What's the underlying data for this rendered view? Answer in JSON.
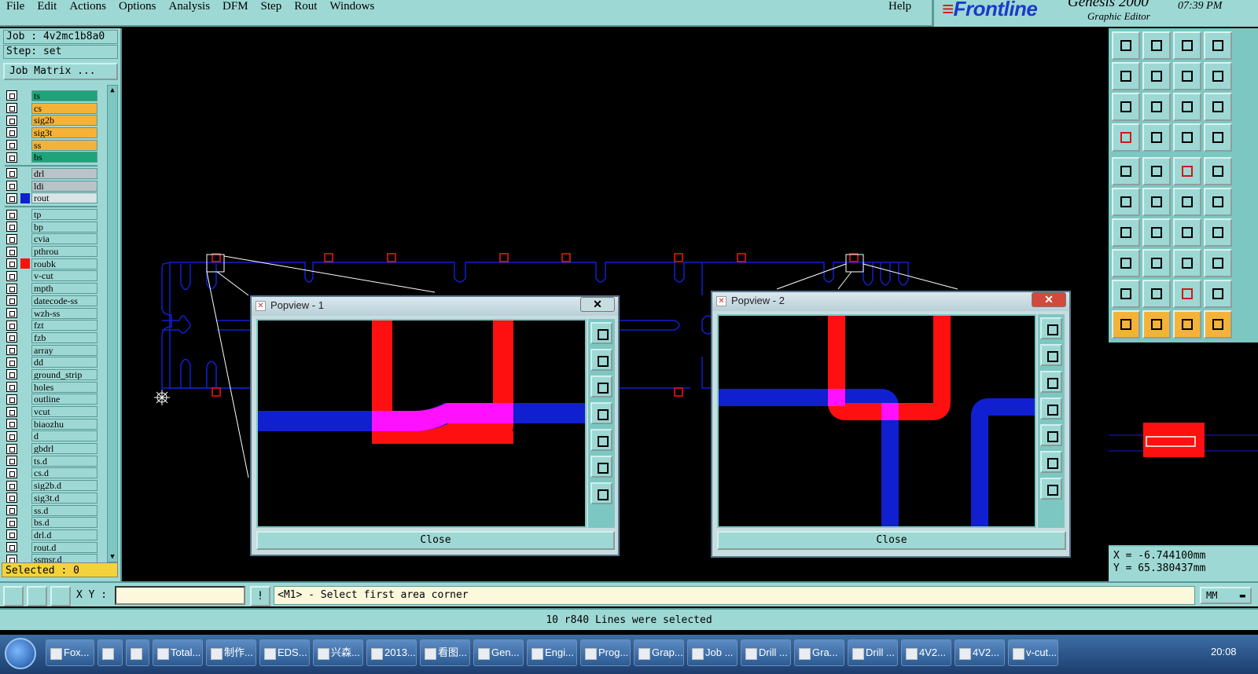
{
  "menu": {
    "items": [
      "File",
      "Edit",
      "Actions",
      "Options",
      "Analysis",
      "DFM",
      "Step",
      "Rout",
      "Windows"
    ],
    "help": "Help"
  },
  "brand": {
    "logo": "Frontline",
    "product": "Genesis 2000",
    "subtitle": "Graphic Editor",
    "time": "07:39 PM"
  },
  "job": {
    "job_line": "Job : 4v2mc1b8a0",
    "step_line": "Step: set",
    "matrix_button": "Job Matrix ..."
  },
  "layers": {
    "group1": [
      {
        "name": "ts",
        "color": "#1ea37a"
      },
      {
        "name": "cs",
        "color": "#f4b338"
      },
      {
        "name": "sig2b",
        "color": "#f4b338"
      },
      {
        "name": "sig3t",
        "color": "#f4b338"
      },
      {
        "name": "ss",
        "color": "#f4b338"
      },
      {
        "name": "bs",
        "color": "#1ea37a"
      }
    ],
    "group2": [
      {
        "name": "drl",
        "color": "#b9c4c8"
      },
      {
        "name": "ldi",
        "color": "#b9c4c8"
      },
      {
        "name": "rout",
        "color": "#d8e4e6",
        "swatch": "#1020d0",
        "active": true
      }
    ],
    "group3": [
      {
        "name": "tp"
      },
      {
        "name": "bp"
      },
      {
        "name": "cvia"
      },
      {
        "name": "pthrou"
      },
      {
        "name": "roubk",
        "swatch": "#ff1010"
      },
      {
        "name": "v-cut"
      },
      {
        "name": "mpth"
      },
      {
        "name": "datecode-ss"
      },
      {
        "name": "wzh-ss"
      },
      {
        "name": "fzt"
      },
      {
        "name": "fzb"
      },
      {
        "name": "array"
      },
      {
        "name": "dd"
      },
      {
        "name": "ground_strip"
      },
      {
        "name": "holes"
      },
      {
        "name": "outline"
      },
      {
        "name": "vcut"
      },
      {
        "name": "biaozhu"
      },
      {
        "name": "d"
      },
      {
        "name": "gbdrl"
      },
      {
        "name": "ts.d"
      },
      {
        "name": "cs.d"
      },
      {
        "name": "sig2b.d"
      },
      {
        "name": "sig3t.d"
      },
      {
        "name": "ss.d"
      },
      {
        "name": "bs.d"
      },
      {
        "name": "drl.d"
      },
      {
        "name": "rout.d"
      },
      {
        "name": "ssmsr.d"
      }
    ],
    "group3_color": "#9ed8d4"
  },
  "selected": "Selected : 0",
  "popview1": {
    "title": "Popview - 1",
    "close_btn": "Close"
  },
  "popview2": {
    "title": "Popview - 2",
    "close_btn": "Close"
  },
  "coords": {
    "x": "X = -6.744100mm",
    "y": "Y = 65.380437mm"
  },
  "cmd": {
    "xy_label": "X Y :",
    "xy_value": "",
    "prompt": "<M1> - Select first area corner",
    "unit": "MM"
  },
  "status": "10 r840 Lines were selected",
  "taskbar": {
    "tasks": [
      "Fox...",
      "",
      "",
      "Total...",
      "制作...",
      "EDS...",
      "兴森...",
      "2013...",
      "看图...",
      "Gen...",
      "Engi...",
      "Prog...",
      "Grap...",
      "Job ...",
      "Drill ...",
      "Gra...",
      "Drill ...",
      "4V2...",
      "4V2...",
      "v-cut..."
    ],
    "clock": "20:08"
  },
  "colors": {
    "panel": "#9ed8d4",
    "route_blue": "#1020d0",
    "pad_red": "#ff1010",
    "overlap_magenta": "#ff10ff"
  }
}
